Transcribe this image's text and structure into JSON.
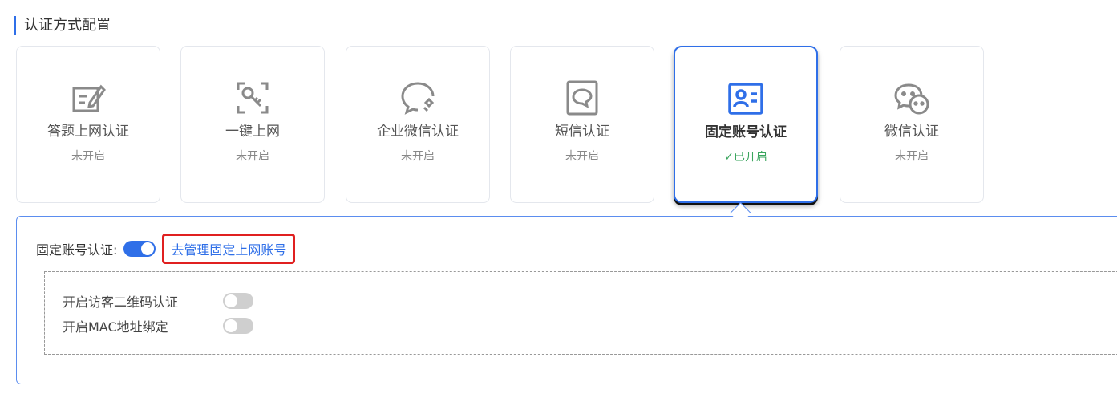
{
  "section": {
    "title": "认证方式配置"
  },
  "cards": [
    {
      "label": "答题上网认证",
      "status": "未开启",
      "icon": "quiz-edit-icon"
    },
    {
      "label": "一键上网",
      "status": "未开启",
      "icon": "key-icon"
    },
    {
      "label": "企业微信认证",
      "status": "未开启",
      "icon": "wecom-icon"
    },
    {
      "label": "短信认证",
      "status": "未开启",
      "icon": "sms-icon"
    },
    {
      "label": "固定账号认证",
      "status": "✓已开启",
      "icon": "id-card-icon",
      "active": true
    },
    {
      "label": "微信认证",
      "status": "未开启",
      "icon": "wechat-icon"
    }
  ],
  "panel": {
    "main_label": "固定账号认证:",
    "main_toggle_on": true,
    "manage_link": "去管理固定上网账号",
    "options": [
      {
        "label": "开启访客二维码认证",
        "enabled": false
      },
      {
        "label": "开启MAC地址绑定",
        "enabled": false
      }
    ]
  },
  "colors": {
    "accent": "#2f6fe8",
    "success": "#3aa55d",
    "highlight_border": "#e02020",
    "icon_gray": "#8a8a8a"
  }
}
